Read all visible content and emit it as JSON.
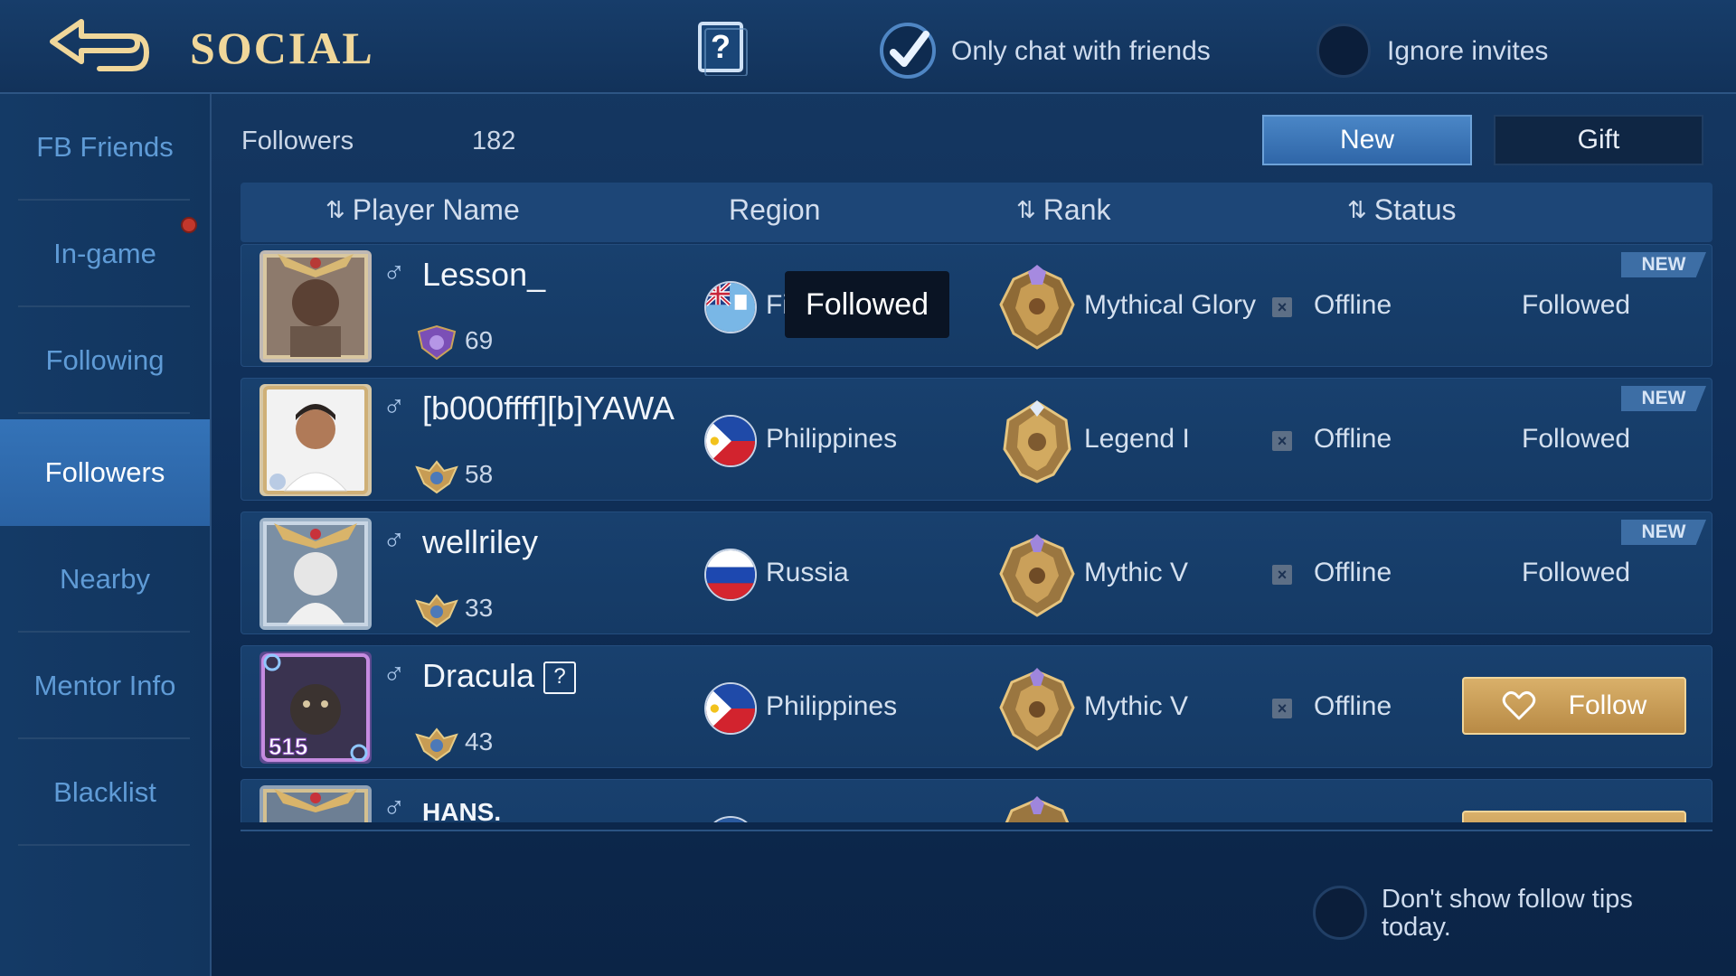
{
  "header": {
    "title": "SOCIAL",
    "only_chat_label": "Only chat with friends",
    "only_chat_checked": true,
    "ignore_invites_label": "Ignore invites",
    "ignore_invites_checked": false
  },
  "sidebar": {
    "items": [
      {
        "label": "FB Friends",
        "active": false,
        "notification": false
      },
      {
        "label": "In-game",
        "active": false,
        "notification": true
      },
      {
        "label": "Following",
        "active": false,
        "notification": false
      },
      {
        "label": "Followers",
        "active": true,
        "notification": false
      },
      {
        "label": "Nearby",
        "active": false,
        "notification": false
      },
      {
        "label": "Mentor Info",
        "active": false,
        "notification": false
      },
      {
        "label": "Blacklist",
        "active": false,
        "notification": false
      }
    ]
  },
  "main": {
    "followers_label": "Followers",
    "followers_count": "182",
    "tabs": {
      "new": "New",
      "gift": "Gift"
    },
    "columns": {
      "player": "Player Name",
      "region": "Region",
      "rank": "Rank",
      "status": "Status"
    },
    "tooltip": "Followed",
    "rows": [
      {
        "name": "Lesson_",
        "level": "69",
        "region": "Fiji",
        "rank": "Mythical Glory",
        "status": "Offline",
        "new_tag": "NEW",
        "relation": "Followed"
      },
      {
        "name": "[b000ffff][b]YAWA",
        "level": "58",
        "region": "Philippines",
        "rank": "Legend I",
        "status": "Offline",
        "new_tag": "NEW",
        "relation": "Followed"
      },
      {
        "name": "wellriley",
        "level": "33",
        "region": "Russia",
        "rank": "Mythic V",
        "status": "Offline",
        "new_tag": "NEW",
        "relation": "Followed"
      },
      {
        "name": "Dracula",
        "level": "43",
        "region": "Philippines",
        "rank": "Mythic V",
        "status": "Offline",
        "follow_label": "Follow"
      },
      {
        "name": "HANS."
      }
    ]
  },
  "footer": {
    "tips_label": "Don't show follow tips today.",
    "tips_checked": false
  },
  "icons": [
    "back-arrow-icon",
    "help-icon",
    "checkmark-icon",
    "male-icon",
    "level-badge-icon",
    "flag-icon",
    "rank-emblem-icon",
    "offline-x-icon",
    "heart-icon",
    "sort-icon"
  ],
  "colors": {
    "accent_gold": "#f0d79a",
    "follow_button": "#c99c55",
    "active_tab": "#3473b8"
  }
}
